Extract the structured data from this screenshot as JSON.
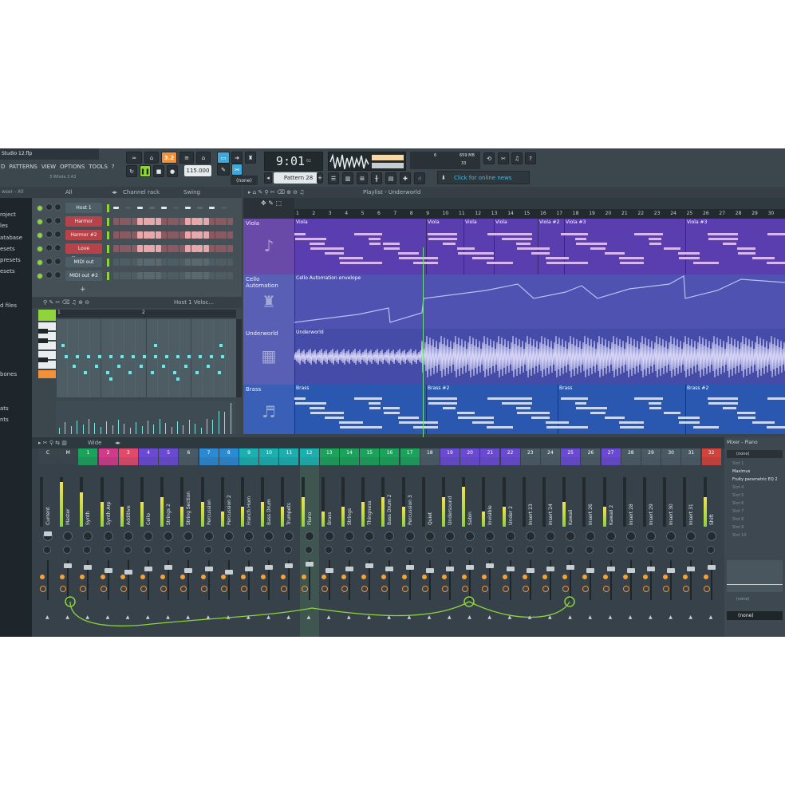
{
  "window": {
    "title": "Studio 12.flp"
  },
  "menu": [
    "D",
    "PATTERNS",
    "VIEW",
    "OPTIONS",
    "TOOLS",
    "?"
  ],
  "transport": {
    "pattern_song_label": "3.2",
    "tempo": "115.000",
    "time": "9:01",
    "time_small": "02",
    "pattern": "Pattern 28",
    "none_value": "(none)",
    "cpu_mem": "659 MB",
    "cpu_value": "6",
    "cpu_poly": "33",
    "news": "Click for online news",
    "tempo_hint": "3 Whole 3 A3"
  },
  "browser": {
    "header": "wser - All",
    "items": [
      "roject",
      "les",
      "atabase",
      "esets",
      "presets",
      "esets",
      "",
      "",
      "d files",
      "",
      "",
      "",
      "",
      "",
      "bones",
      "",
      "",
      "ats",
      "nts"
    ]
  },
  "channel_rack": {
    "title": "Channel rack",
    "filter": "All",
    "swing_label": "Swing",
    "channels": [
      {
        "name": "Host 1",
        "color": "#4e5e66"
      },
      {
        "name": "Harmor",
        "color": "#b8424a"
      },
      {
        "name": "Harmor #2",
        "color": "#b8424a"
      },
      {
        "name": "Love Ph...uency",
        "color": "#b8424a"
      },
      {
        "name": "MIDI out",
        "color": "#4e5e66"
      },
      {
        "name": "MIDI out #2",
        "color": "#4e5e66"
      }
    ]
  },
  "piano_roll": {
    "title": "Host 1  Veloc...",
    "bar1": "1",
    "bar2": "2"
  },
  "playlist": {
    "title": "Playlist - Underworld",
    "ruler": [
      "1",
      "2",
      "3",
      "4",
      "5",
      "6",
      "7",
      "8",
      "9",
      "10",
      "11",
      "12",
      "13",
      "14",
      "15",
      "16",
      "17",
      "18",
      "19",
      "20",
      "21",
      "22",
      "23",
      "24",
      "25",
      "26",
      "27",
      "28",
      "29",
      "30"
    ],
    "tracks": [
      {
        "name": "Viola",
        "clips": [
          "Viola",
          "Viola",
          "Viola",
          "Viola",
          "Viola #2",
          "Viola #3",
          "Viola #3"
        ]
      },
      {
        "name": "Cello Automation",
        "clips": [
          "Cello Automation envelope"
        ]
      },
      {
        "name": "Underworld",
        "clips": [
          "Underworld"
        ]
      },
      {
        "name": "Brass",
        "clips": [
          "Brass",
          "Brass #2",
          "Brass",
          "Brass #2"
        ]
      }
    ]
  },
  "mixer": {
    "title": "Wide",
    "strips": [
      {
        "num": "C",
        "label": "Current",
        "color": "#3a444b"
      },
      {
        "num": "M",
        "label": "Master",
        "color": "#3a444b"
      },
      {
        "num": "1",
        "label": "Synth",
        "color": "#1aa35a"
      },
      {
        "num": "2",
        "label": "Synth Arp",
        "color": "#d43a8a"
      },
      {
        "num": "3",
        "label": "Additive",
        "color": "#e34a6a"
      },
      {
        "num": "4",
        "label": "Cello",
        "color": "#6a4ad4"
      },
      {
        "num": "5",
        "label": "Strings 2",
        "color": "#6a4ad4"
      },
      {
        "num": "6",
        "label": "String Section",
        "color": "#4a5a64"
      },
      {
        "num": "7",
        "label": "Percussion",
        "color": "#2a8ad4"
      },
      {
        "num": "8",
        "label": "Percussion 2",
        "color": "#2a8ad4"
      },
      {
        "num": "9",
        "label": "French Horn",
        "color": "#1ab0b0"
      },
      {
        "num": "10",
        "label": "Bass Drum",
        "color": "#1ab0b0"
      },
      {
        "num": "11",
        "label": "Trumpets",
        "color": "#1ab0b0"
      },
      {
        "num": "12",
        "label": "Piano",
        "color": "#1ab0b0"
      },
      {
        "num": "13",
        "label": "Brass",
        "color": "#1aa35a"
      },
      {
        "num": "14",
        "label": "Strings",
        "color": "#1aa35a"
      },
      {
        "num": "15",
        "label": "Thingness",
        "color": "#1aa35a"
      },
      {
        "num": "16",
        "label": "Bass Drum 2",
        "color": "#1aa35a"
      },
      {
        "num": "17",
        "label": "Percussion 3",
        "color": "#1aa35a"
      },
      {
        "num": "18",
        "label": "Quiet",
        "color": "#4a5a64"
      },
      {
        "num": "19",
        "label": "Undersound",
        "color": "#6a4ad4"
      },
      {
        "num": "20",
        "label": "Sabin",
        "color": "#6a4ad4"
      },
      {
        "num": "21",
        "label": "Invisible",
        "color": "#6a4ad4"
      },
      {
        "num": "22",
        "label": "Under 2",
        "color": "#6a4ad4"
      },
      {
        "num": "23",
        "label": "Insert 23",
        "color": "#4a5a64"
      },
      {
        "num": "24",
        "label": "Insert 24",
        "color": "#4a5a64"
      },
      {
        "num": "25",
        "label": "Kawaii",
        "color": "#6a4ad4"
      },
      {
        "num": "26",
        "label": "Insert 26",
        "color": "#4a5a64"
      },
      {
        "num": "27",
        "label": "Kawaii 2",
        "color": "#6a4ad4"
      },
      {
        "num": "28",
        "label": "Insert 28",
        "color": "#4a5a64"
      },
      {
        "num": "29",
        "label": "Insert 29",
        "color": "#4a5a64"
      },
      {
        "num": "30",
        "label": "Insert 30",
        "color": "#4a5a64"
      },
      {
        "num": "31",
        "label": "Insert 31",
        "color": "#4a5a64"
      },
      {
        "num": "32",
        "label": "Shift",
        "color": "#d4423a"
      }
    ]
  },
  "mixer_inspector": {
    "title": "Mixer - Piano",
    "input": "(none)",
    "slots": [
      "Slot 1",
      "Maximus",
      "Fruity parametric EQ 2",
      "Slot 4",
      "Slot 5",
      "Slot 6",
      "Slot 7",
      "Slot 8",
      "Slot 9",
      "Slot 10"
    ],
    "output": "(none)",
    "output_label": "(none)"
  }
}
